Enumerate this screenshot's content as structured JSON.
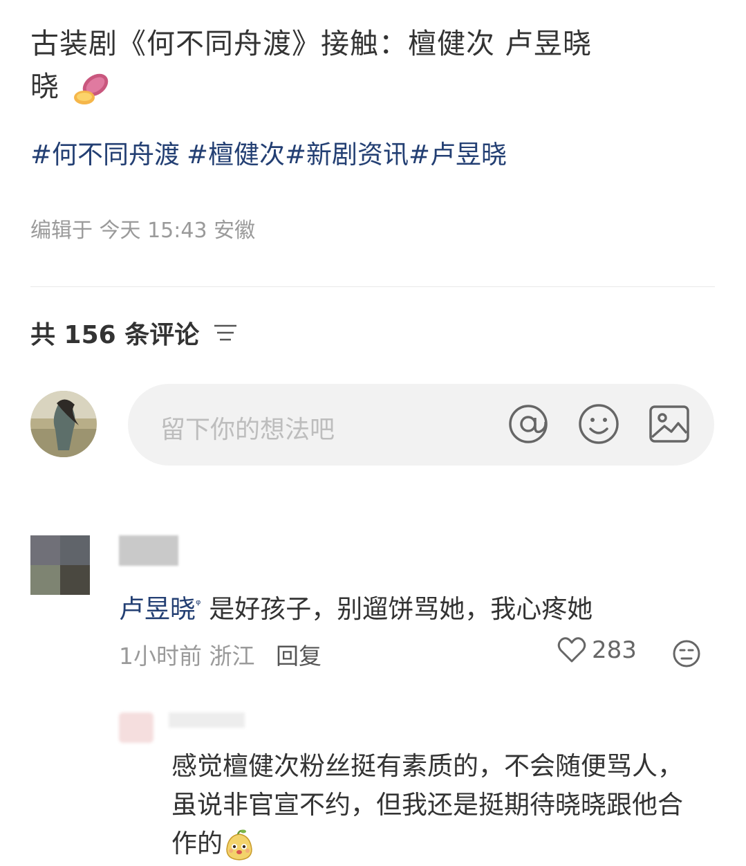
{
  "post": {
    "title": "古装剧《何不同舟渡》接触：檀健次 卢昱晓",
    "title_emoji": "sweet-potato-emoji",
    "tags": [
      "#何不同舟渡",
      "#檀健次#新剧资讯#卢昱晓"
    ],
    "meta": "编辑于 今天 15:43 安徽"
  },
  "comments_header": {
    "count_label": "共 156 条评论",
    "filter_icon": "sort-lines-icon"
  },
  "comment_input": {
    "placeholder": "留下你的想法吧",
    "icons": [
      "at-icon",
      "emoji-icon",
      "image-icon"
    ]
  },
  "comments": [
    {
      "mention": "卢昱晓",
      "mention_icon": "search-icon",
      "text": "是好孩子，别遛饼骂她，我心疼她",
      "time": "1小时前",
      "location": "浙江",
      "reply_label": "回复",
      "likes": "283",
      "replies": [
        {
          "text": "感觉檀健次粉丝挺有素质的，不会随便骂人，虽说非官宣不约，但我还是挺期待晓晓跟他合作的",
          "trailing_emoji": "pear-face-emoji"
        }
      ]
    }
  ],
  "colors": {
    "tag_blue": "#233f73",
    "meta_gray": "#9a9a9a",
    "input_bg": "#f2f2f2"
  }
}
